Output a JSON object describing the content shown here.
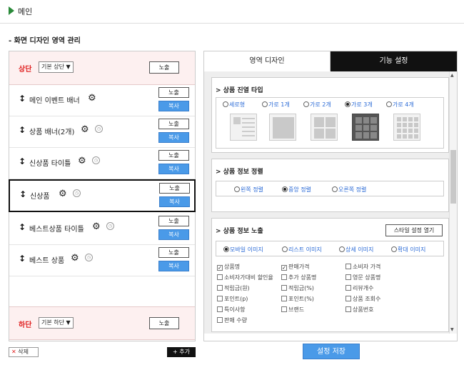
{
  "header": {
    "title": "메인"
  },
  "section_title": "- 화면 디자인 영역 관리",
  "top_zone": {
    "label": "상단",
    "select": "기본 상단",
    "button": "노출"
  },
  "bottom_zone": {
    "label": "하단",
    "select": "기본 하단",
    "button": "노출"
  },
  "rows": [
    {
      "name": "메인 이벤트 배너",
      "show": "노출",
      "copy": "복사",
      "clock": false
    },
    {
      "name": "상품 배너(2개)",
      "show": "노출",
      "copy": "복사",
      "clock": true
    },
    {
      "name": "신상품 타이틀",
      "show": "노출",
      "copy": "복사",
      "clock": true
    },
    {
      "name": "신상품",
      "show": "노출",
      "copy": "복사",
      "clock": true,
      "selected": true
    },
    {
      "name": "베스트상품 타이틀",
      "show": "노출",
      "copy": "복사",
      "clock": true
    },
    {
      "name": "베스트 상품",
      "show": "노출",
      "copy": "복사",
      "clock": true
    }
  ],
  "delete_label": "삭제",
  "add_label": "+ 추가",
  "tabs": {
    "design": "영역 디자인",
    "function": "기능 설정"
  },
  "layout_card": {
    "title": "> 상품 진열 타입",
    "options": [
      "세로형",
      "가로 1개",
      "가로 2개",
      "가로 3개",
      "가로 4개"
    ],
    "selected": 3
  },
  "align_card": {
    "title": "> 상품 정보 정렬",
    "options": [
      "왼쪽 정렬",
      "중앙 정렬",
      "오른쪽 정렬"
    ],
    "selected": 1
  },
  "info_card": {
    "title": "> 상품 정보 노출",
    "style_button": "스타일 설정 열기",
    "image_options": [
      "모바일 이미지",
      "리스트 이미지",
      "상세 이미지",
      "확대 이미지"
    ],
    "image_selected": 0,
    "checks": [
      {
        "label": "상품명",
        "checked": true
      },
      {
        "label": "판매가격",
        "checked": true
      },
      {
        "label": "소비자 가격",
        "checked": false
      },
      {
        "label": "소비자가대비 할인율",
        "checked": false
      },
      {
        "label": "추가 상품명",
        "checked": false
      },
      {
        "label": "영문 상품명",
        "checked": false
      },
      {
        "label": "적립금(원)",
        "checked": false
      },
      {
        "label": "적립금(%)",
        "checked": false
      },
      {
        "label": "리뷰개수",
        "checked": false
      },
      {
        "label": "포인트(p)",
        "checked": false
      },
      {
        "label": "포인트(%)",
        "checked": false
      },
      {
        "label": "상품 조회수",
        "checked": false
      },
      {
        "label": "특이사항",
        "checked": false
      },
      {
        "label": "브랜드",
        "checked": false
      },
      {
        "label": "상품번호",
        "checked": false
      },
      {
        "label": "판매 수량",
        "checked": false
      }
    ]
  },
  "save_label": "설정 저장",
  "colors": {
    "accent": "#4a9ae8",
    "danger": "#e02020",
    "active_tab": "#111111"
  }
}
